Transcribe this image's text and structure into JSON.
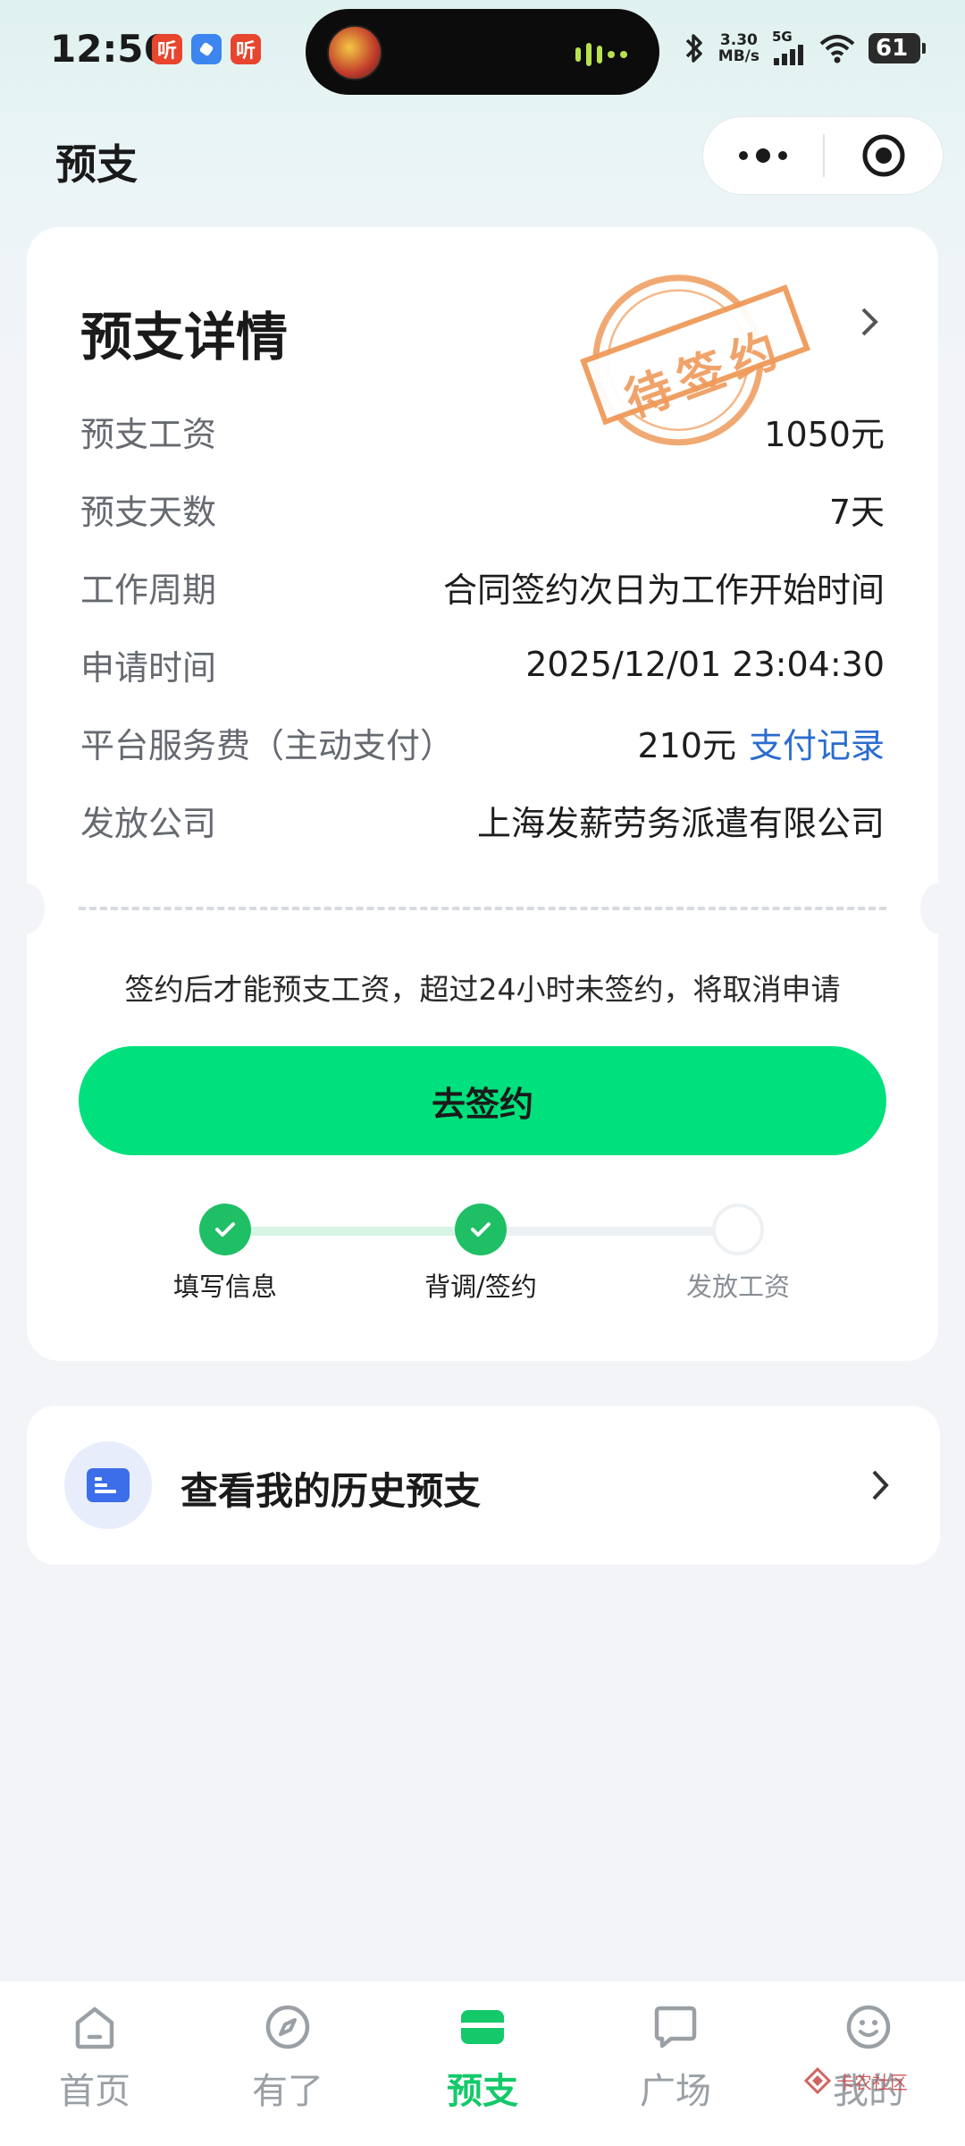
{
  "status_bar": {
    "time": "12:56",
    "badges": [
      "听",
      "",
      "听"
    ],
    "net_speed_value": "3.30",
    "net_speed_unit": "MB/s",
    "network_type": "5G",
    "battery": "61"
  },
  "nav": {
    "title": "预支"
  },
  "detail": {
    "title": "预支详情",
    "stamp_text": "待签约",
    "rows": [
      {
        "label": "预支工资",
        "value": "1050元"
      },
      {
        "label": "预支天数",
        "value": "7天"
      },
      {
        "label": "工作周期",
        "value": "合同签约次日为工作开始时间"
      },
      {
        "label": "申请时间",
        "value": "2025/12/01 23:04:30"
      },
      {
        "label": "平台服务费（主动支付）",
        "value": "210元",
        "link": "支付记录"
      },
      {
        "label": "发放公司",
        "value": "上海发薪劳务派遣有限公司"
      }
    ],
    "notice": "签约后才能预支工资，超过24小时未签约，将取消申请",
    "sign_button": "去签约",
    "steps": [
      {
        "label": "填写信息",
        "done": true
      },
      {
        "label": "背调/签约",
        "done": true
      },
      {
        "label": "发放工资",
        "done": false
      }
    ]
  },
  "history": {
    "label": "查看我的历史预支"
  },
  "tabbar": {
    "tabs": [
      {
        "label": "首页",
        "icon": "home-icon",
        "active": false
      },
      {
        "label": "有了",
        "icon": "compass-icon",
        "active": false
      },
      {
        "label": "预支",
        "icon": "card-icon",
        "active": true
      },
      {
        "label": "广场",
        "icon": "chat-icon",
        "active": false
      },
      {
        "label": "我的",
        "icon": "smile-icon",
        "active": false
      }
    ]
  },
  "watermark": "卡农社区",
  "colors": {
    "accent": "#00e07c",
    "active_tab": "#14c96a",
    "link": "#2b6ccf",
    "stamp": "#ef9a5a"
  }
}
